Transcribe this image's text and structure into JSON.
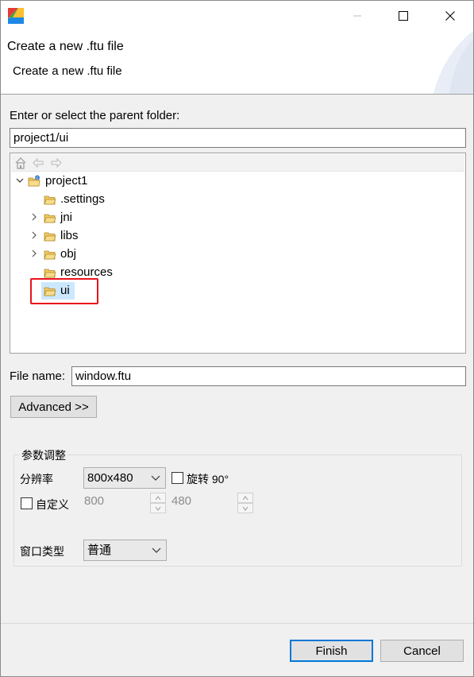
{
  "dialog": {
    "header_title": "Create a new .ftu file",
    "header_description": "Create a new .ftu file"
  },
  "parent_folder": {
    "label": "Enter or select the parent folder:",
    "value": "project1/ui"
  },
  "tree": {
    "root": "project1",
    "items": [
      ".settings",
      "jni",
      "libs",
      "obj",
      "resources",
      "ui"
    ],
    "selected": "ui"
  },
  "file_name": {
    "label": "File name:",
    "value": "window.ftu"
  },
  "advanced_label": "Advanced >>",
  "params": {
    "group_title": "参数调整",
    "resolution_label": "分辨率",
    "resolution_value": "800x480",
    "rotate_label": "旋转 90°",
    "custom_label": "自定义",
    "custom_width": "800",
    "custom_height": "480",
    "window_type_label": "窗口类型",
    "window_type_value": "普通"
  },
  "buttons": {
    "finish": "Finish",
    "cancel": "Cancel"
  },
  "colors": {
    "selection": "#cce8ff",
    "highlight_box": "#e8141c",
    "default_button_border": "#0078d7"
  }
}
